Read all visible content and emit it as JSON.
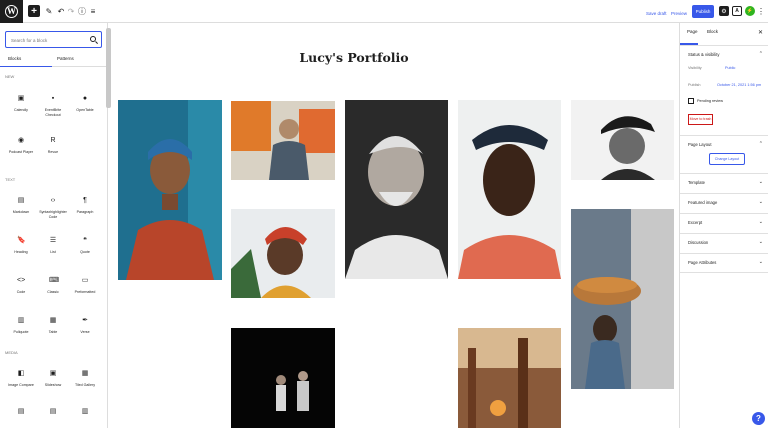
{
  "topbar": {
    "save_draft": "Save draft",
    "preview": "Preview",
    "publish": "Publish"
  },
  "inserter": {
    "search_placeholder": "Search for a block",
    "tabs": [
      "Blocks",
      "Patterns"
    ],
    "categories": {
      "new": "NEW",
      "text": "TEXT",
      "media": "MEDIA"
    },
    "new_blocks": [
      "Calendly",
      "EventBrite Checkout",
      "OpenTable",
      "Podcast Player",
      "Revue"
    ],
    "text_blocks": [
      "Markdown",
      "Syntaxhighlighter Code",
      "Paragraph",
      "Heading",
      "List",
      "Quote",
      "Code",
      "Classic",
      "Preformatted",
      "Pullquote",
      "Table",
      "Verse"
    ],
    "media_blocks": [
      "Image Compare",
      "Slideshow",
      "Tiled Gallery"
    ]
  },
  "editor": {
    "page_title": "Lucy's Portfolio"
  },
  "settings": {
    "tabs": [
      "Page",
      "Block"
    ],
    "sections": {
      "status": "Status & visibility",
      "layout": "Page Layout",
      "template": "Template",
      "featured": "Featured image",
      "excerpt": "Excerpt",
      "discussion": "Discussion",
      "attributes": "Page Attributes"
    },
    "visibility_label": "Visibility",
    "visibility_value": "Public",
    "publish_label": "Publish",
    "publish_value": "October 21, 2021 1:56 pm",
    "pending_review": "Pending review",
    "move_to_trash": "Move to trash",
    "change_layout": "Change Layout"
  },
  "help_label": "?"
}
